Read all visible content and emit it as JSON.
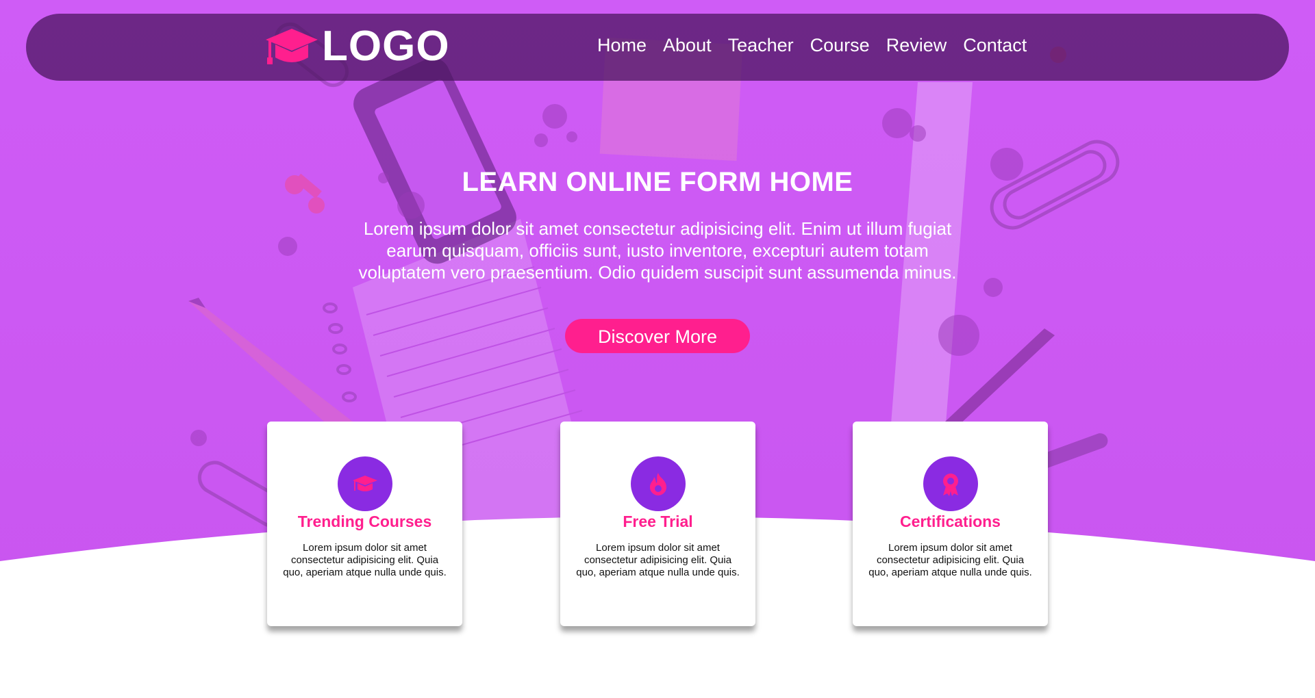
{
  "colors": {
    "hero_purple": "#d05cf5",
    "navbar_bg": "#46145a",
    "accent_pink": "#ff1f8e",
    "icon_circle_purple": "#8a2be2",
    "white": "#ffffff"
  },
  "header": {
    "logo_icon": "graduation-cap-icon",
    "logo_text": "LOGO",
    "nav": [
      {
        "label": "Home"
      },
      {
        "label": "About"
      },
      {
        "label": "Teacher"
      },
      {
        "label": "Course"
      },
      {
        "label": "Review"
      },
      {
        "label": "Contact"
      }
    ]
  },
  "hero": {
    "title": "LEARN ONLINE FORM HOME",
    "text": "Lorem ipsum dolor sit amet consectetur adipisicing elit. Enim ut illum fugiat earum quisquam, officiis sunt, iusto inventore, excepturi autem totam voluptatem vero praesentium. Odio quidem suscipit sunt assumenda minus.",
    "button_label": "Discover More"
  },
  "features": [
    {
      "icon": "graduation-cap-icon",
      "title": "Trending Courses",
      "text": "Lorem ipsum dolor sit amet consectetur adipisicing elit. Quia quo, aperiam atque nulla unde quis."
    },
    {
      "icon": "fire-icon",
      "title": "Free Trial",
      "text": "Lorem ipsum dolor sit amet consectetur adipisicing elit. Quia quo, aperiam atque nulla unde quis."
    },
    {
      "icon": "award-icon",
      "title": "Certifications",
      "text": "Lorem ipsum dolor sit amet consectetur adipisicing elit. Quia quo, aperiam atque nulla unde quis."
    }
  ]
}
